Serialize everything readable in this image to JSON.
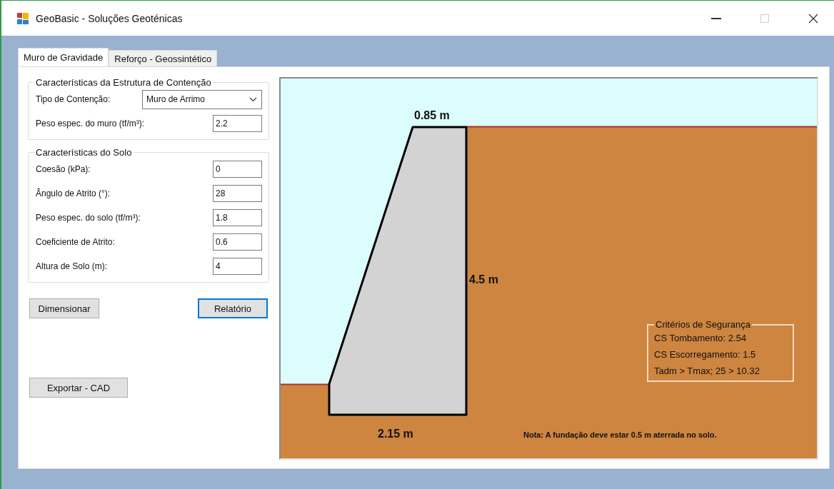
{
  "window": {
    "title": "GeoBasic - Soluções Geoténicas"
  },
  "tabs": [
    {
      "label": "Muro de Gravidade",
      "selected": true
    },
    {
      "label": "Reforço - Geossintético",
      "selected": false
    }
  ],
  "groups": [
    {
      "title": "Características da Estrutura de Contenção",
      "fields": [
        {
          "kind": "dropdown",
          "label": "Tipo de Contenção:",
          "value": "Muro de Arrimo"
        },
        {
          "kind": "text",
          "label": "Peso espec. do muro (tf/m³):",
          "value": "2.2"
        }
      ]
    },
    {
      "title": "Características do Solo",
      "fields": [
        {
          "kind": "text",
          "label": "Coesão (kPa):",
          "value": "0"
        },
        {
          "kind": "text",
          "label": "Ângulo de Atrito (°):",
          "value": "28"
        },
        {
          "kind": "text",
          "label": "Peso espec. do solo (tf/m³):",
          "value": "1.8"
        },
        {
          "kind": "text",
          "label": "Coeficiente de Atrito:",
          "value": "0.6"
        },
        {
          "kind": "text",
          "label": "Altura de Solo (m):",
          "value": "4"
        }
      ]
    }
  ],
  "buttons": [
    {
      "label": "Dimensionar",
      "focused": false
    },
    {
      "label": "Relatório",
      "focused": true
    }
  ],
  "export_button": {
    "label": "Exportar - CAD",
    "focused": false
  },
  "drawing": {
    "top_width": "0.85 m",
    "height": "4.5 m",
    "base_width": "2.15 m",
    "note": "Nota: A fundação deve estar 0.5 m aterrada no solo.",
    "criteria": {
      "title": "Critérios de Segurança",
      "lines": [
        "CS Tombamento: 2.54",
        "CS Escorregamento: 1.5",
        "Tadm > Tmax; 25 > 10.32"
      ]
    }
  }
}
